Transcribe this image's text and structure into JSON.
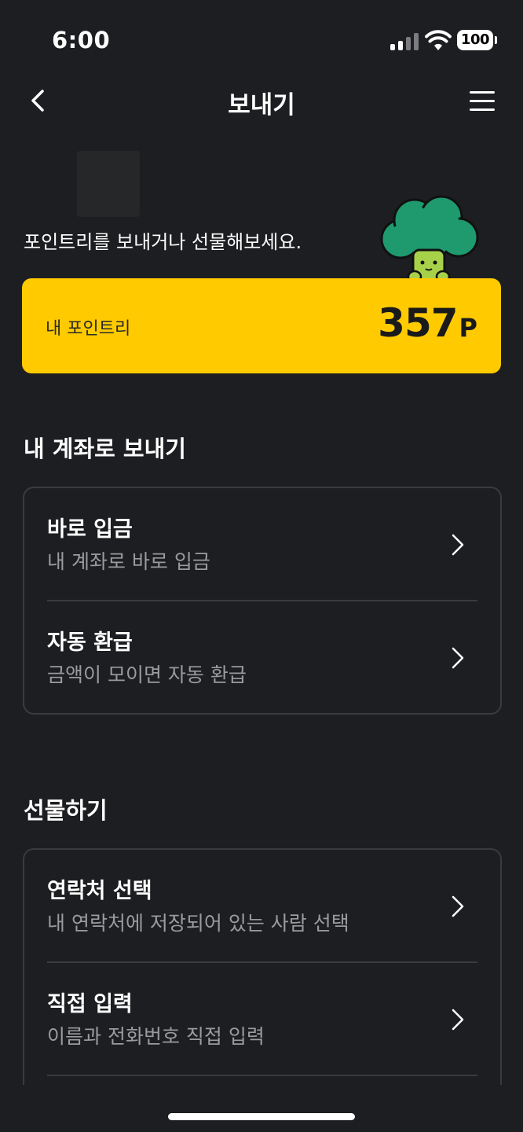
{
  "status_bar": {
    "time": "6:00",
    "battery": "100"
  },
  "nav": {
    "title": "보내기"
  },
  "header": {
    "subtitle": "포인트리를 보내거나 선물해보세요."
  },
  "points": {
    "label": "내 포인트리",
    "value": "357",
    "unit": "P"
  },
  "colors": {
    "background": "#1d1e21",
    "accent": "#ffcb00",
    "card_border": "#3a3b3f",
    "secondary_text": "#9a9b9f"
  },
  "sections": [
    {
      "title": "내 계좌로 보내기",
      "items": [
        {
          "title": "바로 입금",
          "description": "내 계좌로 바로 입금",
          "icon": "chevron-right-icon"
        },
        {
          "title": "자동 환급",
          "description": "금액이 모이면 자동 환급",
          "icon": "chevron-right-icon"
        }
      ]
    },
    {
      "title": "선물하기",
      "items": [
        {
          "title": "연락처 선택",
          "description": "내 연락처에 저장되어 있는 사람 선택",
          "icon": "chevron-right-icon"
        },
        {
          "title": "직접 입력",
          "description": "이름과 전화번호 직접 입력",
          "icon": "chevron-right-icon"
        }
      ]
    }
  ]
}
